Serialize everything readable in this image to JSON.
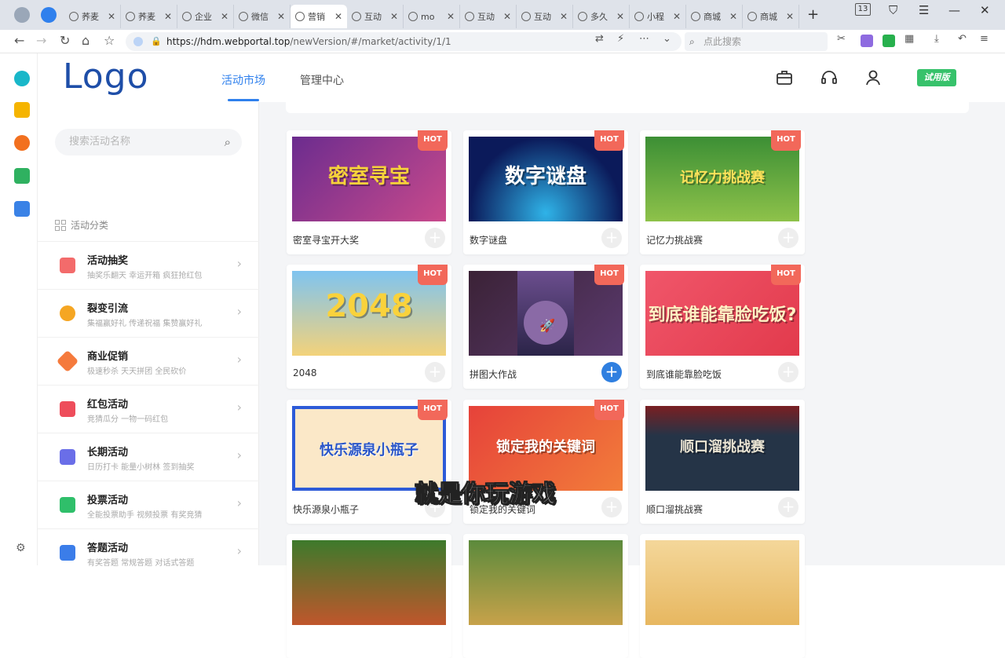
{
  "browser": {
    "tabs": [
      {
        "title": "荞麦"
      },
      {
        "title": "荞麦"
      },
      {
        "title": "企业"
      },
      {
        "title": "微信"
      },
      {
        "title": "营销"
      },
      {
        "title": "互动"
      },
      {
        "title": "mo"
      },
      {
        "title": "互动"
      },
      {
        "title": "互动"
      },
      {
        "title": "多久"
      },
      {
        "title": "小程"
      },
      {
        "title": "商城"
      },
      {
        "title": "商城"
      }
    ],
    "badge": "13",
    "url_host": "https://hdm.webportal.top",
    "url_path": "/newVersion/#/market/activity/1/1",
    "search_placeholder": "点此搜索"
  },
  "header": {
    "logo": "Logo",
    "nav": [
      "活动市场",
      "管理中心"
    ],
    "trial_label": "试用版"
  },
  "sidebar": {
    "search_placeholder": "搜索活动名称",
    "category_heading": "活动分类",
    "categories": [
      {
        "name": "活动抽奖",
        "desc": "抽奖乐翻天   幸运开箱   疯狂抢红包",
        "color": "#f36b6b"
      },
      {
        "name": "裂变引流",
        "desc": "集福赢好礼   传递祝福   集赞赢好礼",
        "color": "#f5a623"
      },
      {
        "name": "商业促销",
        "desc": "极速秒杀   天天拼团   全民砍价",
        "color": "#f57a3c"
      },
      {
        "name": "红包活动",
        "desc": "竞猜瓜分   一物一码红包",
        "color": "#ee4d5b"
      },
      {
        "name": "长期活动",
        "desc": "日历打卡   能量小树林   签到抽奖",
        "color": "#6a6ee8"
      },
      {
        "name": "投票活动",
        "desc": "全能投票助手   视频投票   有奖竞猜",
        "color": "#2fbf6a"
      },
      {
        "name": "答题活动",
        "desc": "有奖答题   常规答题   对话式答题",
        "color": "#3b7de9"
      }
    ]
  },
  "cards": [
    {
      "name": "密室寻宝开大奖",
      "img_text": "密室寻宝",
      "hot": "HOT"
    },
    {
      "name": "数字谜盘",
      "img_text": "数字谜盘",
      "hot": "HOT"
    },
    {
      "name": "记忆力挑战赛",
      "img_text": "记忆力挑战赛",
      "hot": "HOT"
    },
    {
      "name": "2048",
      "img_text": "2048",
      "hot": "HOT"
    },
    {
      "name": "拼图大作战",
      "img_text": "",
      "hot": "HOT"
    },
    {
      "name": "到底谁能靠脸吃饭",
      "img_text": "到底谁能靠脸吃饭?",
      "hot": "HOT"
    },
    {
      "name": "快乐源泉小瓶子",
      "img_text": "快乐源泉小瓶子",
      "hot": "HOT"
    },
    {
      "name": "锁定我的关键词",
      "img_text": "锁定我的关键词",
      "hot": "HOT"
    },
    {
      "name": "顺口溜挑战赛",
      "img_text": "顺口溜挑战赛",
      "hot": ""
    }
  ],
  "subtitle": "就是你玩游戏"
}
